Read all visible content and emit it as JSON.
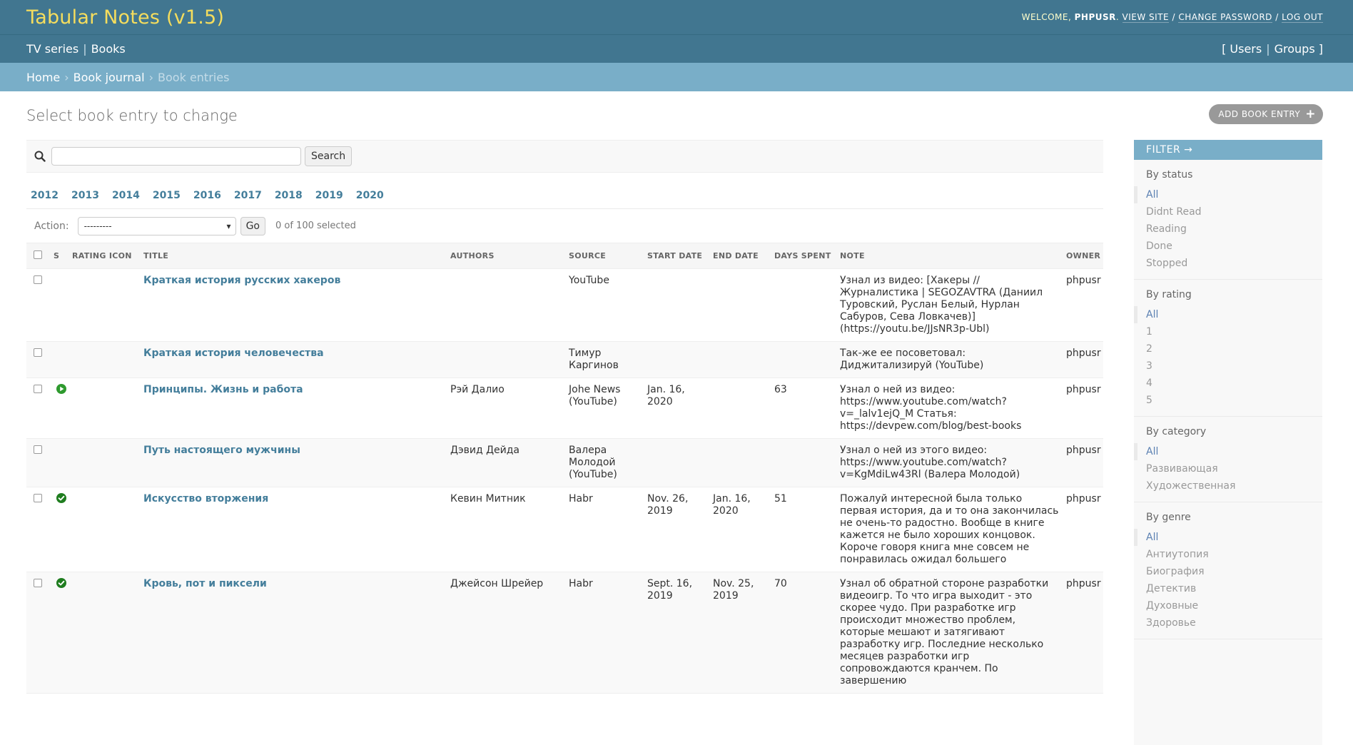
{
  "header": {
    "branding": "Tabular Notes (v1.5)",
    "welcome": "WELCOME,",
    "username": "PHPUSR",
    "view_site": "VIEW SITE",
    "change_password": "CHANGE PASSWORD",
    "log_out": "LOG OUT",
    "sep": "/"
  },
  "navbar": {
    "left": [
      "TV series",
      "Books"
    ],
    "right_open": "[",
    "users": "Users",
    "groups": "Groups",
    "right_close": "]",
    "pipe": "|"
  },
  "breadcrumbs": {
    "home": "Home",
    "journal": "Book journal",
    "current": "Book entries",
    "sep": "›"
  },
  "page": {
    "title": "Select book entry to change",
    "add_button": "ADD BOOK ENTRY",
    "add_plus": "+"
  },
  "search": {
    "value": "",
    "button": "Search"
  },
  "date_hierarchy": [
    "2012",
    "2013",
    "2014",
    "2015",
    "2016",
    "2017",
    "2018",
    "2019",
    "2020"
  ],
  "actions": {
    "label": "Action:",
    "selected_option": "---------",
    "go": "Go",
    "counter": "0 of 100 selected"
  },
  "table": {
    "columns": [
      "S",
      "RATING ICON",
      "TITLE",
      "AUTHORS",
      "SOURCE",
      "START DATE",
      "END DATE",
      "DAYS SPENT",
      "NOTE",
      "OWNER"
    ],
    "rows": [
      {
        "status": "none",
        "title": "Краткая история русских хакеров",
        "authors": "",
        "source": "YouTube",
        "start": "",
        "end": "",
        "days": "",
        "note": "Узнал из видео: [Хакеры // Журналистика | SEGOZAVTRA (Даниил Туровский, Руслан Белый, Нурлан Сабуров, Сева Ловкачев)](https://youtu.be/JJsNR3p-Ubl)",
        "owner": "phpusr"
      },
      {
        "status": "none",
        "title": "Краткая история человечества",
        "authors": "",
        "source": "Тимур Каргинов",
        "start": "",
        "end": "",
        "days": "",
        "note": "Так-же ее посоветовал: Диджитализируй (YouTube)",
        "owner": "phpusr"
      },
      {
        "status": "reading",
        "title": "Принципы. Жизнь и работа",
        "authors": "Рэй Далио",
        "source": "Johe News (YouTube)",
        "start": "Jan. 16, 2020",
        "end": "",
        "days": "63",
        "note": "Узнал о ней из видео: https://www.youtube.com/watch?v=_lalv1ejQ_M Статья: https://devpew.com/blog/best-books",
        "owner": "phpusr"
      },
      {
        "status": "none",
        "title": "Путь настоящего мужчины",
        "authors": "Дэвид Дейда",
        "source": "Валера Молодой (YouTube)",
        "start": "",
        "end": "",
        "days": "",
        "note": "Узнал о ней из этого видео: https://www.youtube.com/watch?v=KgMdiLw43Rl (Валера Молодой)",
        "owner": "phpusr"
      },
      {
        "status": "done",
        "title": "Искусство вторжения",
        "authors": "Кевин Митник",
        "source": "Habr",
        "start": "Nov. 26, 2019",
        "end": "Jan. 16, 2020",
        "days": "51",
        "note": "Пожалуй интересной была только первая история, да и то она закончилась не очень-то радостно. Вообще в книге кажется не было хороших концовок. Короче говоря книга мне совсем не понравилась ожидал большего",
        "owner": "phpusr"
      },
      {
        "status": "done",
        "title": "Кровь, пот и пиксели",
        "authors": "Джейсон Шрейер",
        "source": "Habr",
        "start": "Sept. 16, 2019",
        "end": "Nov. 25, 2019",
        "days": "70",
        "note": "Узнал об обратной стороне разработки видеоигр. То что игра выходит - это скорее чудо. При разработке игр происходит множество проблем, которые мешают и затягивают разработку игр. Последние несколько месяцев разработки игр сопровождаются кранчем. По завершению",
        "owner": "phpusr"
      }
    ]
  },
  "filter": {
    "title": "FILTER →",
    "groups": [
      {
        "name": "By status",
        "items": [
          "All",
          "Didnt Read",
          "Reading",
          "Done",
          "Stopped"
        ]
      },
      {
        "name": "By rating",
        "items": [
          "All",
          "1",
          "2",
          "3",
          "4",
          "5"
        ]
      },
      {
        "name": "By category",
        "items": [
          "All",
          "Развивающая",
          "Художественная"
        ]
      },
      {
        "name": "By genre",
        "items": [
          "All",
          "Антиутопия",
          "Биография",
          "Детектив",
          "Духовные",
          "Здоровье"
        ]
      }
    ]
  },
  "colors": {
    "header_bg": "#417690",
    "breadcrumb_bg": "#79aec8",
    "branding": "#f5dd5d",
    "link": "#447e9b",
    "status_green": "#2e9a2e",
    "status_done": "#1f7d1f"
  }
}
